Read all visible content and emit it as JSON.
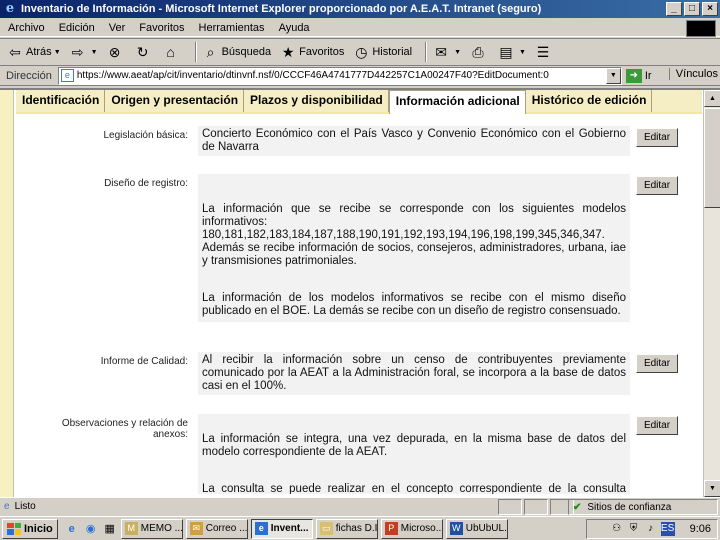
{
  "window": {
    "title": "Inventario de Información - Microsoft Internet Explorer proporcionado por A.E.A.T. Intranet (seguro)",
    "buttons": [
      "_",
      "□",
      "×"
    ]
  },
  "menu": [
    "Archivo",
    "Edición",
    "Ver",
    "Favoritos",
    "Herramientas",
    "Ayuda"
  ],
  "toolbar": {
    "back": "Atrás",
    "search": "Búsqueda",
    "favorites": "Favoritos",
    "history": "Historial"
  },
  "address": {
    "label": "Dirección",
    "url": "https://www.aeat/ap/cit/inventario/dtinvnf.nsf/0/CCCF46A4741777D442257C1A00247F40?EditDocument:0",
    "go": "Ir",
    "links": "Vínculos"
  },
  "tabs": [
    "Identificación",
    "Origen y presentación",
    "Plazos y disponibilidad",
    "Información adicional",
    "Histórico de edición"
  ],
  "active_tab": "Información adicional",
  "fields": [
    {
      "label": "Legislación básica:",
      "value": "Concierto Económico con el País Vasco y Convenio Económico con el Gobierno de Navarra",
      "button": "Editar"
    },
    {
      "label": "Diseño de registro:",
      "paragraphs": [
        "La información que se recibe se corresponde con los siguientes modelos informativos: 180,181,182,183,184,187,188,190,191,192,193,194,196,198,199,345,346,347. Además se recibe información de socios, consejeros, administradores, urbana, iae y transmisiones patrimoniales.",
        "La información de los modelos informativos se recibe con el mismo diseño publicado en el BOE. La demás se recibe con un diseño de registro consensuado."
      ],
      "button": "Editar"
    },
    {
      "label": "Informe de Calidad:",
      "value": "Al recibir la información sobre un censo de contribuyentes previamente comunicado por la AEAT a la Administración foral, se incorpora a la base de datos casi en el 100%.",
      "button": "Editar"
    },
    {
      "label": "Observaciones y relación de anexos:",
      "paragraphs": [
        "La información se integra, una vez depurada, en la misma base de datos del modelo correspondiente de la AEAT.",
        "La consulta se puede realizar en el concepto correspondiente de la consulta integral de cada contribuyente. Se puede distinguir la procedencia del dato"
      ],
      "button": "Editar"
    }
  ],
  "status": {
    "left": "Listo",
    "zone": "Sitios de confianza"
  },
  "taskbar": {
    "start": "Inicio",
    "items": [
      "MEMO ...",
      "Correo ...",
      "Invent...",
      "fichas D.I",
      "Microso...",
      "UbUbUL..."
    ],
    "active": "Invent...",
    "clock": "9:06"
  },
  "colors": {
    "tab_bar": "#f5eec4",
    "title_gradient_start": "#0a246a",
    "title_gradient_end": "#3a6ea5",
    "field_bg": "#f2f2f2"
  }
}
